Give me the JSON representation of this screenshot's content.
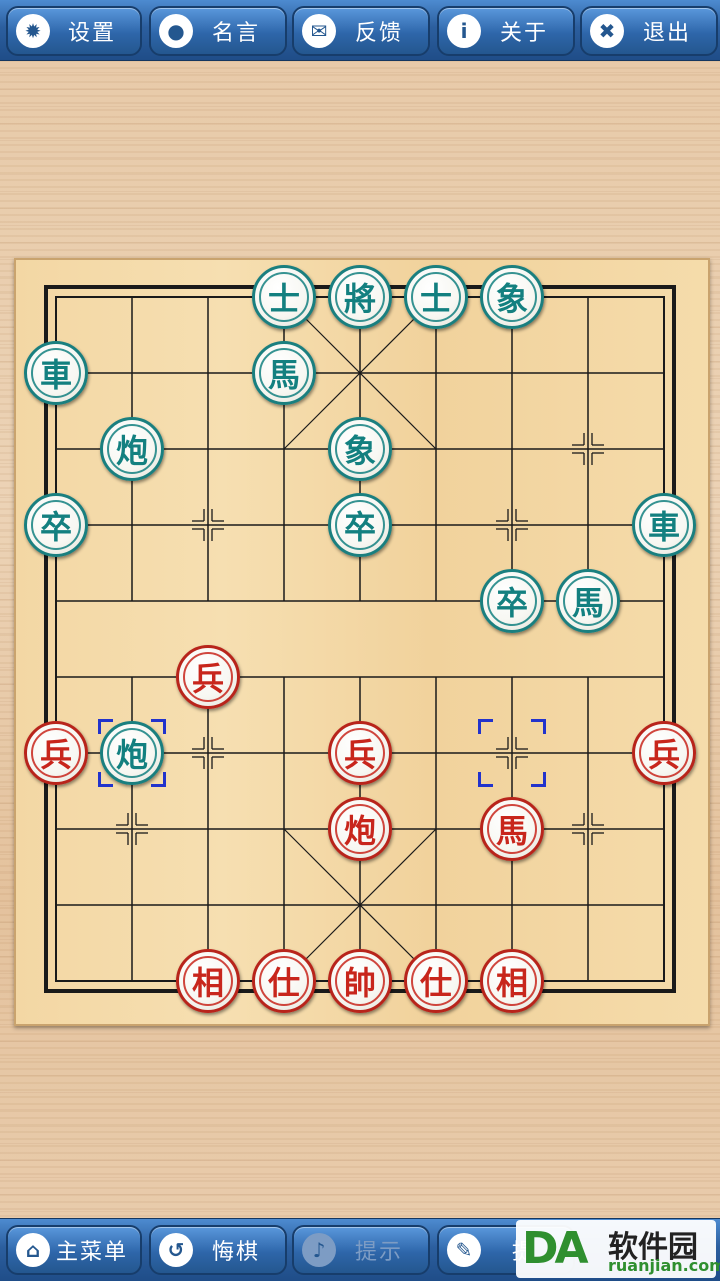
{
  "top_bar": [
    {
      "label": "设置",
      "icon": "gear-icon",
      "glyph": "✹"
    },
    {
      "label": "名言",
      "icon": "speech-bubble-icon",
      "glyph": "●"
    },
    {
      "label": "反馈",
      "icon": "envelope-icon",
      "glyph": "✉"
    },
    {
      "label": "关于",
      "icon": "info-icon",
      "glyph": "i"
    },
    {
      "label": "退出",
      "icon": "close-icon",
      "glyph": "✖"
    }
  ],
  "bottom_bar": [
    {
      "label": "主菜单",
      "icon": "home-icon",
      "glyph": "⌂",
      "enabled": true
    },
    {
      "label": "悔棋",
      "icon": "undo-icon",
      "glyph": "↺",
      "enabled": true
    },
    {
      "label": "提示",
      "icon": "bell-icon",
      "glyph": "♪",
      "enabled": false
    },
    {
      "label": "提",
      "icon": "pencil-icon",
      "glyph": "✎",
      "enabled": true
    }
  ],
  "board": {
    "files": 9,
    "ranks": 10,
    "selection_markers": [
      [
        1,
        6
      ],
      [
        6,
        6
      ]
    ]
  },
  "pieces": [
    {
      "char": "士",
      "side": "black",
      "file": 3,
      "rank": 0
    },
    {
      "char": "將",
      "side": "black",
      "file": 4,
      "rank": 0
    },
    {
      "char": "士",
      "side": "black",
      "file": 5,
      "rank": 0
    },
    {
      "char": "象",
      "side": "black",
      "file": 6,
      "rank": 0
    },
    {
      "char": "車",
      "side": "black",
      "file": 0,
      "rank": 1
    },
    {
      "char": "馬",
      "side": "black",
      "file": 3,
      "rank": 1
    },
    {
      "char": "炮",
      "side": "black",
      "file": 1,
      "rank": 2
    },
    {
      "char": "象",
      "side": "black",
      "file": 4,
      "rank": 2
    },
    {
      "char": "卒",
      "side": "black",
      "file": 0,
      "rank": 3
    },
    {
      "char": "卒",
      "side": "black",
      "file": 4,
      "rank": 3
    },
    {
      "char": "車",
      "side": "black",
      "file": 8,
      "rank": 3
    },
    {
      "char": "卒",
      "side": "black",
      "file": 6,
      "rank": 4
    },
    {
      "char": "馬",
      "side": "black",
      "file": 7,
      "rank": 4
    },
    {
      "char": "炮",
      "side": "black",
      "file": 1,
      "rank": 6
    },
    {
      "char": "兵",
      "side": "red",
      "file": 2,
      "rank": 5
    },
    {
      "char": "兵",
      "side": "red",
      "file": 0,
      "rank": 6
    },
    {
      "char": "兵",
      "side": "red",
      "file": 4,
      "rank": 6
    },
    {
      "char": "兵",
      "side": "red",
      "file": 8,
      "rank": 6
    },
    {
      "char": "炮",
      "side": "red",
      "file": 4,
      "rank": 7
    },
    {
      "char": "馬",
      "side": "red",
      "file": 6,
      "rank": 7
    },
    {
      "char": "相",
      "side": "red",
      "file": 2,
      "rank": 9
    },
    {
      "char": "仕",
      "side": "red",
      "file": 3,
      "rank": 9
    },
    {
      "char": "帥",
      "side": "red",
      "file": 4,
      "rank": 9
    },
    {
      "char": "仕",
      "side": "red",
      "file": 5,
      "rank": 9
    },
    {
      "char": "相",
      "side": "red",
      "file": 6,
      "rank": 9
    }
  ],
  "watermark": {
    "logo": "DA",
    "title": "软件园",
    "url": "ruanjian.com"
  },
  "colors": {
    "black_piece": "#138080",
    "red_piece": "#c8261c",
    "grid": "#1a1a1a",
    "toolbar": "#2c5f9f"
  }
}
